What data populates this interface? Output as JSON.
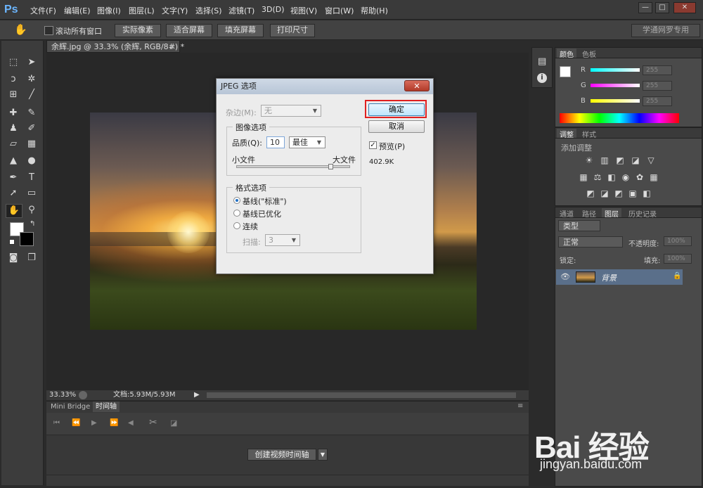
{
  "app": {
    "logo": "Ps"
  },
  "menu": [
    "文件(F)",
    "编辑(E)",
    "图像(I)",
    "图层(L)",
    "文字(Y)",
    "选择(S)",
    "滤镜(T)",
    "3D(D)",
    "视图(V)",
    "窗口(W)",
    "帮助(H)"
  ],
  "window_controls": {
    "minimize": "—",
    "restore": "□",
    "close": "✕"
  },
  "options_bar": {
    "scroll_all_label": "滚动所有窗口",
    "buttons": [
      "实际像素",
      "适合屏幕",
      "填充屏幕",
      "打印尺寸"
    ],
    "workspace": "学通网罗专用"
  },
  "document": {
    "tab_title": "余辉.jpg @ 33.3% (余辉, RGB/8#) *",
    "zoom": "33.33%",
    "doc_size": "文档:5.93M/5.93M"
  },
  "timeline_panel": {
    "tabs": [
      "Mini Bridge",
      "时间轴"
    ],
    "create_button": "创建视频时间轴"
  },
  "color_panel": {
    "tabs": [
      "颜色",
      "色板"
    ],
    "channels": [
      {
        "name": "R",
        "value": "255"
      },
      {
        "name": "G",
        "value": "255"
      },
      {
        "name": "B",
        "value": "255"
      }
    ]
  },
  "adjust_panel": {
    "tabs": [
      "调整",
      "样式"
    ],
    "hint": "添加调整"
  },
  "layers_panel": {
    "tabs": [
      "通道",
      "路径",
      "图层",
      "历史记录"
    ],
    "filter_type": "类型",
    "blend_mode": "正常",
    "opacity_label": "不透明度:",
    "opacity_value": "100%",
    "lock_label": "锁定:",
    "fill_label": "填充:",
    "fill_value": "100%",
    "layer_name": "背景"
  },
  "dialog": {
    "title": "JPEG 选项",
    "matte_label": "杂边(M):",
    "matte_value": "无",
    "image_options_legend": "图像选项",
    "quality_label": "品质(Q):",
    "quality_value": "10",
    "quality_preset": "最佳",
    "small_file": "小文件",
    "large_file": "大文件",
    "quality_fraction": 0.83,
    "format_legend": "格式选项",
    "format_options": [
      "基线(\"标准\")",
      "基线已优化",
      "连续"
    ],
    "format_selected": 0,
    "scans_label": "扫描:",
    "scans_value": "3",
    "ok_label": "确定",
    "cancel_label": "取消",
    "preview_label": "预览(P)",
    "preview_checked": true,
    "file_size": "402.9K",
    "close_glyph": "✕"
  },
  "watermark": {
    "brand": "Bai 经验",
    "url": "jingyan.baidu.com"
  },
  "colors": {
    "ok_highlight": "#e02020",
    "selected_layer": "#5a6f8a",
    "accent": "#6cb6ff"
  }
}
